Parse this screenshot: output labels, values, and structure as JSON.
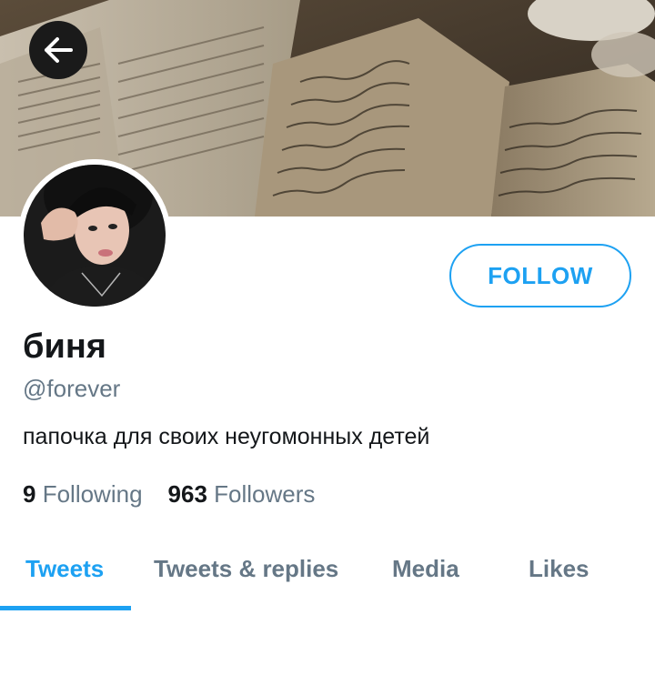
{
  "profile": {
    "name": "биня",
    "handle": "@forever",
    "bio": "папочка для своих неугомонных детей",
    "follow_label": "FOLLOW"
  },
  "stats": {
    "following_count": "9",
    "following_label": "Following",
    "followers_count": "963",
    "followers_label": "Followers"
  },
  "tabs": [
    {
      "label": "Tweets",
      "active": true
    },
    {
      "label": "Tweets & replies",
      "active": false
    },
    {
      "label": "Media",
      "active": false
    },
    {
      "label": "Likes",
      "active": false
    }
  ],
  "icons": {
    "back": "arrow-left-icon"
  },
  "colors": {
    "accent": "#1da1f2",
    "text_primary": "#14171a",
    "text_secondary": "#657786"
  }
}
